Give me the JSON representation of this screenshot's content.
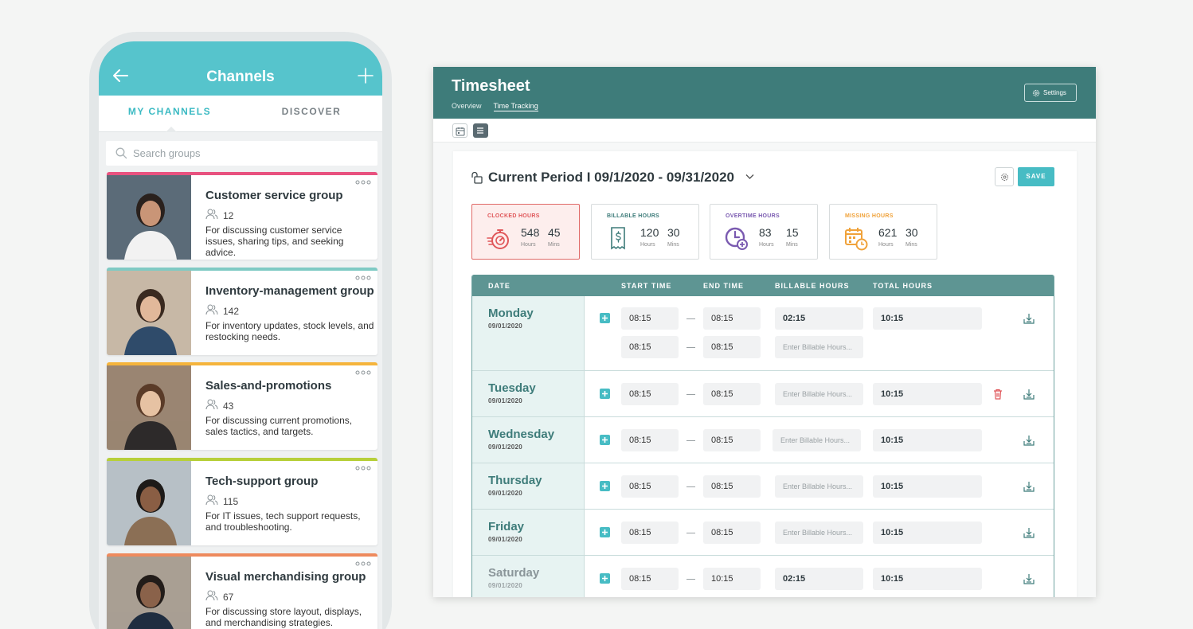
{
  "phone": {
    "title": "Channels",
    "tabs": [
      "MY CHANNELS",
      "DISCOVER"
    ],
    "search_placeholder": "Search groups",
    "groups": [
      {
        "name": "Customer service group",
        "members": "12",
        "desc": "For discussing customer service issues, sharing tips, and seeking advice.",
        "color": "#e8527f"
      },
      {
        "name": "Inventory-management group",
        "members": "142",
        "desc": "For inventory updates, stock levels, and restocking needs.",
        "color": "#7fcac4"
      },
      {
        "name": "Sales-and-promotions",
        "members": "43",
        "desc": "For discussing current promotions, sales tactics, and targets.",
        "color": "#f5b43c"
      },
      {
        "name": "Tech-support group",
        "members": "115",
        "desc": "For IT issues, tech support requests, and troubleshooting.",
        "color": "#b7cf3a"
      },
      {
        "name": "Visual merchandising group",
        "members": "67",
        "desc": "For discussing store layout, displays, and merchandising strategies.",
        "color": "#ee8a5d"
      }
    ]
  },
  "timesheet": {
    "title": "Timesheet",
    "nav": [
      "Overview",
      "Time Tracking"
    ],
    "settings_label": "Settings",
    "period": "Current Period I 09/1/2020 - 09/31/2020",
    "save_label": "SAVE",
    "stats": [
      {
        "label": "CLOCKED HOURS",
        "hours": "548",
        "mins": "45",
        "color": "#e0575a",
        "icon": "stopwatch-icon"
      },
      {
        "label": "BILLABLE HOURS",
        "hours": "120",
        "mins": "30",
        "color": "#3e7c7a",
        "icon": "receipt-dollar-icon"
      },
      {
        "label": "OVERTIME HOURS",
        "hours": "83",
        "mins": "15",
        "color": "#7a5ab0",
        "icon": "clock-plus-icon"
      },
      {
        "label": "MISSING HOURS",
        "hours": "621",
        "mins": "30",
        "color": "#f0a23a",
        "icon": "calendar-clock-icon"
      }
    ],
    "units": {
      "hours": "Hours",
      "mins": "Mins"
    },
    "columns": [
      "DATE",
      "START TIME",
      "END TIME",
      "BILLABLE HOURS",
      "TOTAL HOURS"
    ],
    "billable_placeholder": "Enter Billable Hours...",
    "rows": [
      {
        "day": "Monday",
        "date": "09/01/2020",
        "entries": [
          {
            "start": "08:15",
            "end": "08:15",
            "billable": "02:15",
            "total": "10:15"
          },
          {
            "start": "08:15",
            "end": "08:15",
            "billable": "",
            "total": ""
          }
        ],
        "delete": false,
        "muted": false
      },
      {
        "day": "Tuesday",
        "date": "09/01/2020",
        "entries": [
          {
            "start": "08:15",
            "end": "08:15",
            "billable": "",
            "total": "10:15"
          }
        ],
        "delete": true,
        "muted": false
      },
      {
        "day": "Wednesday",
        "date": "09/01/2020",
        "entries": [
          {
            "start": "08:15",
            "end": "08:15",
            "billable": "",
            "total": "10:15"
          }
        ],
        "delete": false,
        "muted": false
      },
      {
        "day": "Thursday",
        "date": "09/01/2020",
        "entries": [
          {
            "start": "08:15",
            "end": "08:15",
            "billable": "",
            "total": "10:15"
          }
        ],
        "delete": false,
        "muted": false
      },
      {
        "day": "Friday",
        "date": "09/01/2020",
        "entries": [
          {
            "start": "08:15",
            "end": "08:15",
            "billable": "",
            "total": "10:15"
          }
        ],
        "delete": false,
        "muted": false
      },
      {
        "day": "Saturday",
        "date": "09/01/2020",
        "entries": [
          {
            "start": "08:15",
            "end": "10:15",
            "billable": "02:15",
            "total": "10:15"
          }
        ],
        "delete": false,
        "muted": true
      }
    ]
  }
}
